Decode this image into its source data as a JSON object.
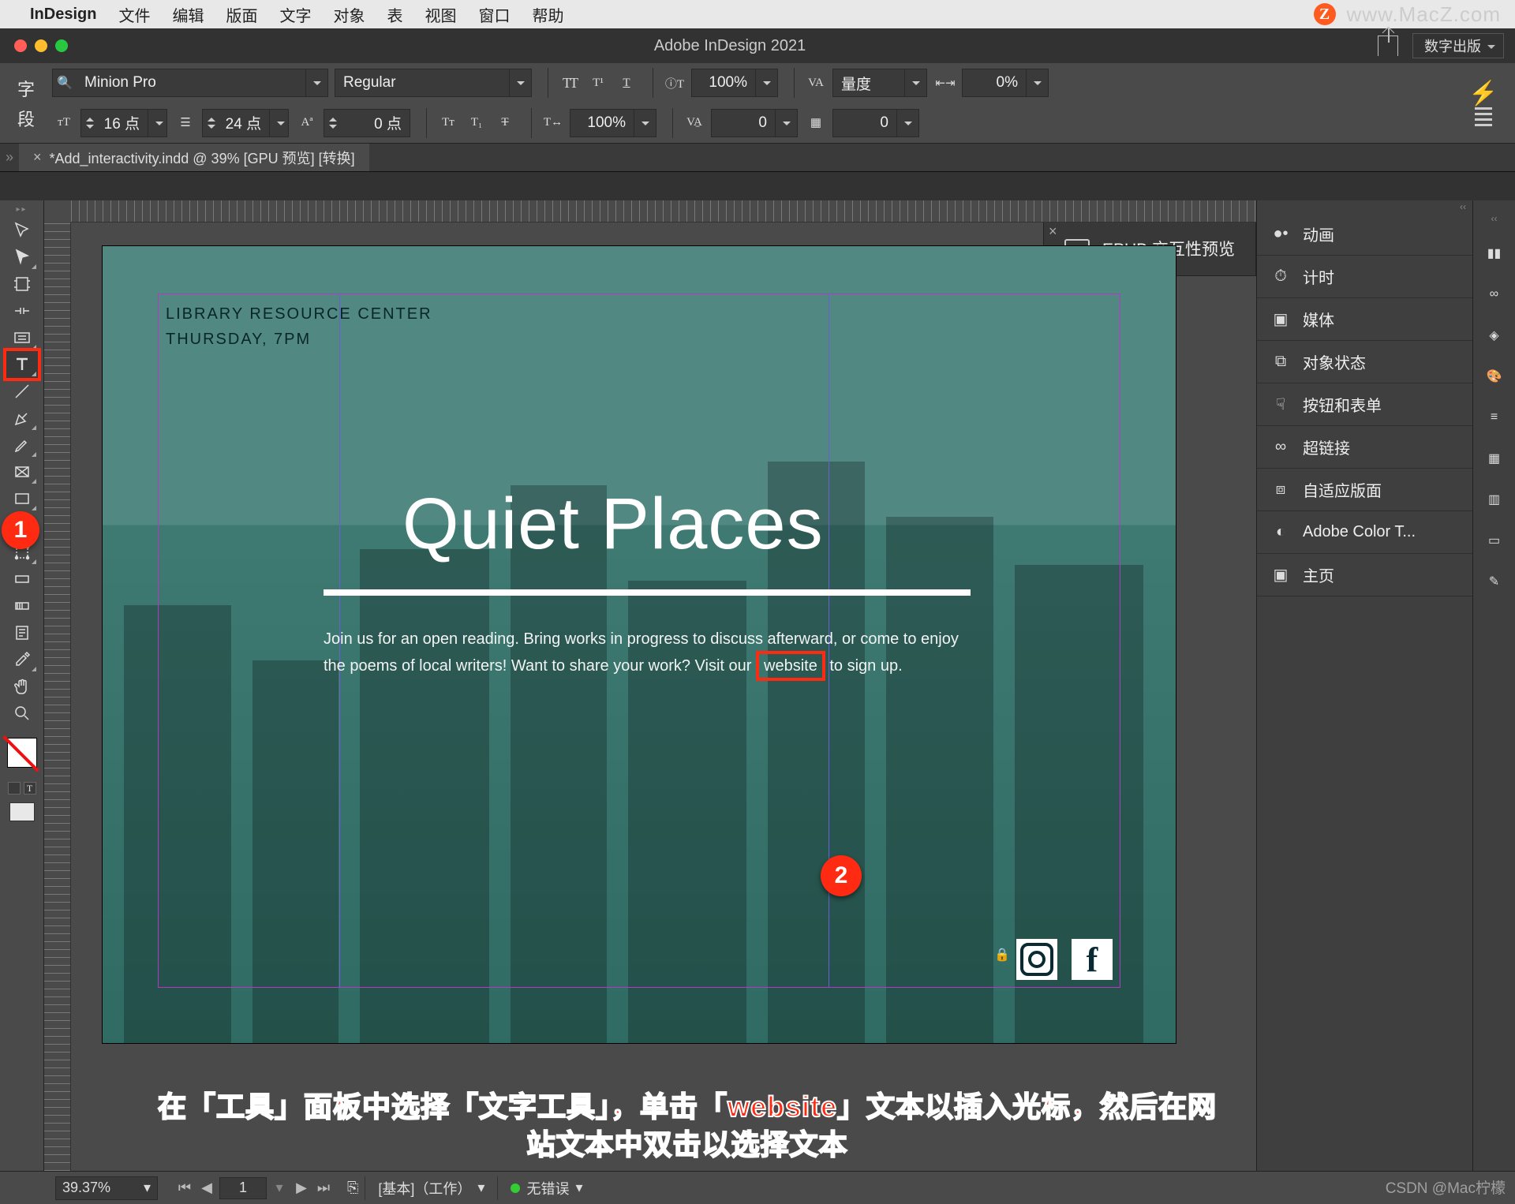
{
  "mac_menu": {
    "app_name": "InDesign",
    "items": [
      "文件",
      "编辑",
      "版面",
      "文字",
      "对象",
      "表",
      "视图",
      "窗口",
      "帮助"
    ],
    "watermark": "www.MacZ.com",
    "z_badge": "Z"
  },
  "titlebar": {
    "title": "Adobe InDesign 2021",
    "workspace_label": "数字出版"
  },
  "control": {
    "left_char": "字",
    "left_para": "段",
    "font_family": "Minion Pro",
    "font_style": "Regular",
    "scale_a": "100%",
    "scale_b": "100%",
    "metric_label": "量度",
    "pct0": "0%",
    "font_size": "16 点",
    "leading": "24 点",
    "baseline": "0 点",
    "tracking_a": "0",
    "tracking_b": "0"
  },
  "doc_tab": {
    "name": "*Add_interactivity.indd @ 39% [GPU 预览] [转换]"
  },
  "epub_panel": "EPUB 交互性预览",
  "panels": [
    {
      "icon": "●●",
      "label": "动画"
    },
    {
      "icon": "⏱",
      "label": "计时"
    },
    {
      "icon": "▦",
      "label": "媒体"
    },
    {
      "icon": "⧉",
      "label": "对象状态"
    },
    {
      "icon": "☟",
      "label": "按钮和表单"
    },
    {
      "icon": "🔗",
      "label": "超链接"
    },
    {
      "icon": "⧈",
      "label": "自适应版面"
    },
    {
      "icon": "◐",
      "label": "Adobe Color T..."
    },
    {
      "icon": "▣",
      "label": "主页"
    }
  ],
  "page": {
    "header_line1": "LIBRARY RESOURCE CENTER",
    "header_line2": "THURSDAY, 7PM",
    "title": "Quiet Places",
    "body_pre": "Join us for an open reading. Bring works in progress to discuss afterward, or come to enjoy the poems of local writers! Want to share your work? Visit our ",
    "body_link": "website",
    "body_post": " to sign up."
  },
  "annotation": {
    "line1": "在「工具」面板中选择「文字工具」，单击「website」文本以插入光标，然后在网",
    "line2": "站文本中双击以选择文本"
  },
  "callouts": {
    "one": "1",
    "two": "2"
  },
  "status": {
    "zoom": "39.37%",
    "page_no": "1",
    "profile": "[基本]（工作）",
    "errors": "无错误",
    "csdn": "CSDN @Mac柠檬"
  }
}
